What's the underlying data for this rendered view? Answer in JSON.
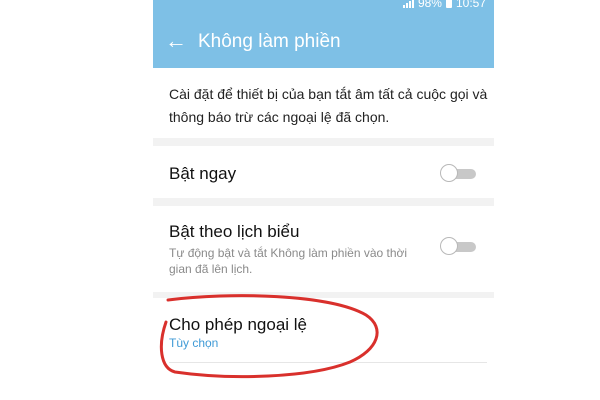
{
  "status_bar": {
    "battery_percent": "98%",
    "time": "10:57"
  },
  "app_bar": {
    "back_icon": "arrow-back",
    "title": "Không làm phiền"
  },
  "description": "Cài đặt để thiết bị của bạn tắt âm tất cả cuộc gọi và thông báo trừ các ngoại lệ đã chọn.",
  "settings": {
    "turn_on_now": {
      "label": "Bật ngay",
      "enabled": false
    },
    "scheduled": {
      "label": "Bật theo lịch biểu",
      "summary": "Tự động bật và tắt Không làm phiền vào thời gian đã lên lịch.",
      "enabled": false
    },
    "exceptions": {
      "label": "Cho phép ngoại lệ",
      "summary": "Tùy chọn"
    }
  },
  "colors": {
    "app_bar": "#7ec0e6",
    "background": "#f2f2f2",
    "link": "#3f9ad6",
    "annotation": "#d9302c"
  }
}
